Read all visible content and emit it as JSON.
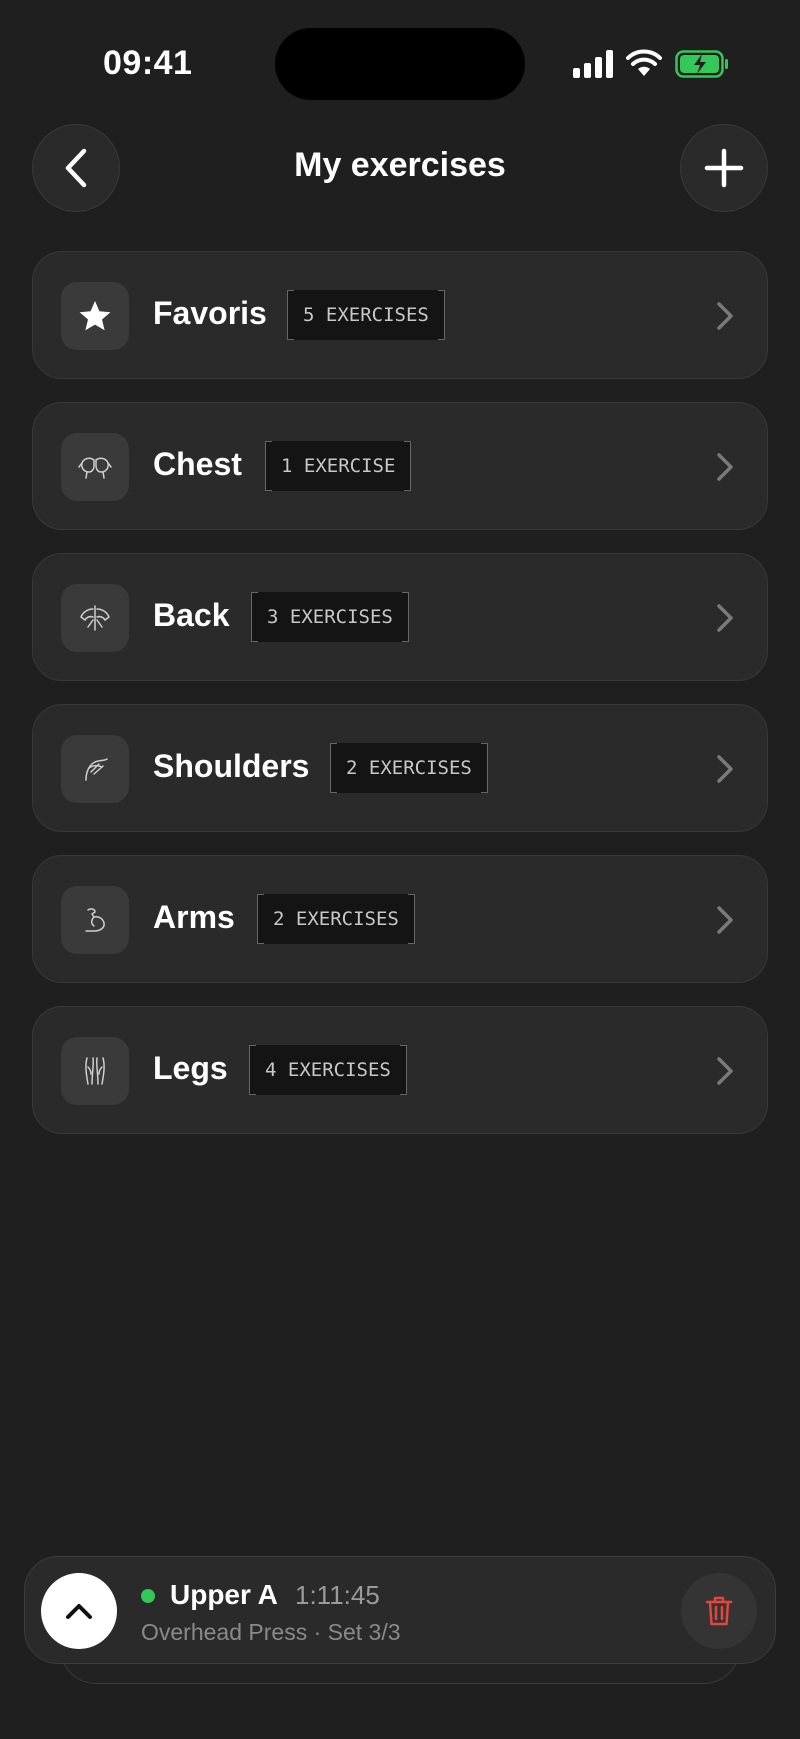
{
  "status_bar": {
    "time": "09:41"
  },
  "header": {
    "title": "My exercises"
  },
  "categories": [
    {
      "label": "Favoris",
      "badge": "5 EXERCISES",
      "icon": "star-icon"
    },
    {
      "label": "Chest",
      "badge": "1 EXERCISE",
      "icon": "chest-muscle-icon"
    },
    {
      "label": "Back",
      "badge": "3 EXERCISES",
      "icon": "back-muscle-icon"
    },
    {
      "label": "Shoulders",
      "badge": "2 EXERCISES",
      "icon": "shoulder-muscle-icon"
    },
    {
      "label": "Arms",
      "badge": "2 EXERCISES",
      "icon": "arm-muscle-icon"
    },
    {
      "label": "Legs",
      "badge": "4 EXERCISES",
      "icon": "leg-muscle-icon"
    }
  ],
  "player": {
    "workout_name": "Upper A",
    "elapsed": "1:11:45",
    "subtitle": "Overhead Press · Set 3/3",
    "live_color": "#34c759",
    "delete_color": "#e5453b"
  }
}
